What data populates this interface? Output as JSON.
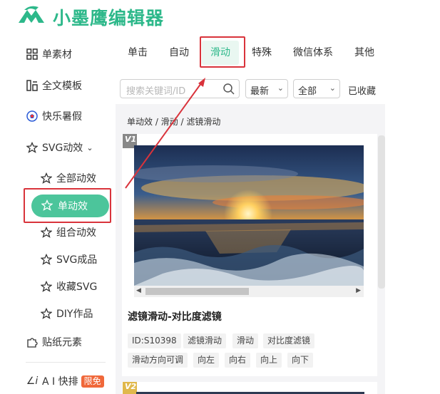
{
  "header": {
    "logo_text": "小墨鹰编辑器"
  },
  "sidebar": {
    "items": [
      {
        "label": "单素材",
        "icon": "grid-icon"
      },
      {
        "label": "全文模板",
        "icon": "template-icon"
      },
      {
        "label": "快乐暑假",
        "icon": "soccer-ball-icon"
      },
      {
        "label": "SVG动效",
        "icon": "star-outline-icon"
      }
    ],
    "svg_sub": [
      {
        "label": "全部动效"
      },
      {
        "label": "单动效"
      },
      {
        "label": "组合动效"
      },
      {
        "label": "SVG成品"
      },
      {
        "label": "收藏SVG"
      },
      {
        "label": "DIY作品"
      }
    ],
    "stickers": "贴纸元素",
    "ai_label": "A I 快排",
    "ai_badge": "限免"
  },
  "tabs": [
    "单击",
    "自动",
    "滑动",
    "特殊",
    "微信体系",
    "其他"
  ],
  "active_tab": "滑动",
  "filters": {
    "search_placeholder": "搜索关键词/ID",
    "sort_value": "最新",
    "scope_value": "全部",
    "favorites": "已收藏"
  },
  "breadcrumb": "单动效 / 滑动 / 滤镜滑动",
  "card": {
    "badge": "V1",
    "title": "滤镜滑动-对比度滤镜",
    "tags": [
      "ID:S10398",
      "滤镜滑动",
      "滑动",
      "对比度滤镜",
      "滑动方向可调",
      "向左",
      "向右",
      "向上",
      "向下"
    ]
  },
  "card2": {
    "badge": "V2"
  },
  "colors": {
    "brand": "#2db88a",
    "active_pill": "#4cc59b",
    "highlight": "#d9333b",
    "badge_free": "#f0683a"
  }
}
